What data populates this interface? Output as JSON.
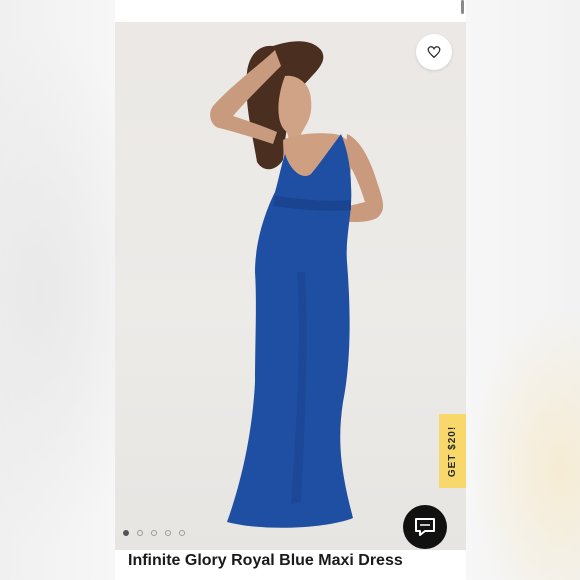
{
  "product": {
    "title": "Infinite Glory Royal Blue Maxi Dress",
    "image_description_icon": "dress-photo"
  },
  "promo": {
    "label": "GET $20!"
  },
  "carousel": {
    "count": 5,
    "active": 1
  },
  "icons": {
    "favorite": "heart-icon",
    "chat": "chat-bubble-icon"
  },
  "colors": {
    "dress": "#1f4fa3",
    "promo": "#f8d86a",
    "chat_bg": "#111111"
  }
}
